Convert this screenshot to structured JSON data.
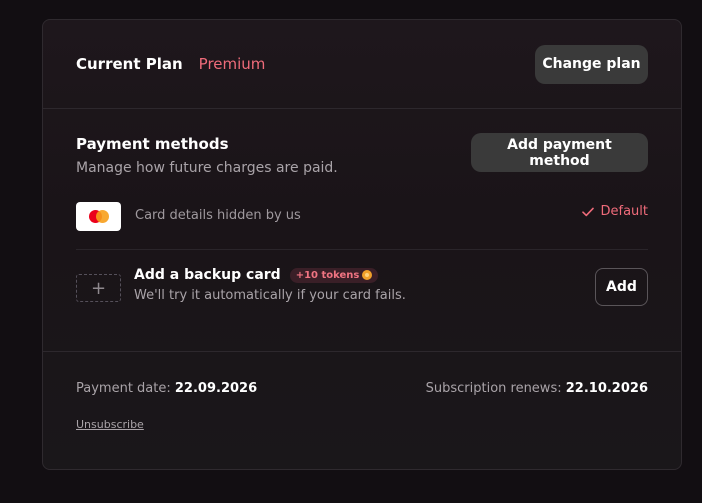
{
  "plan": {
    "label": "Current Plan",
    "name": "Premium",
    "change_button": "Change plan"
  },
  "payment_methods": {
    "title": "Payment methods",
    "description": "Manage how future charges are paid.",
    "add_button": "Add payment method",
    "card": {
      "brand_icon": "mastercard-icon",
      "text": "Card details hidden by us",
      "default_label": "Default"
    },
    "backup": {
      "title": "Add a backup card",
      "badge": "+10 tokens",
      "description": "We'll try it automatically if your card fails.",
      "add_button": "Add"
    }
  },
  "footer": {
    "payment_date_label": "Payment date:",
    "payment_date": "22.09.2026",
    "renews_label": "Subscription renews:",
    "renews_date": "22.10.2026",
    "unsubscribe": "Unsubscribe"
  },
  "colors": {
    "accent": "#ef6b7a",
    "background": "#120e12",
    "button": "#3a3a3a"
  }
}
